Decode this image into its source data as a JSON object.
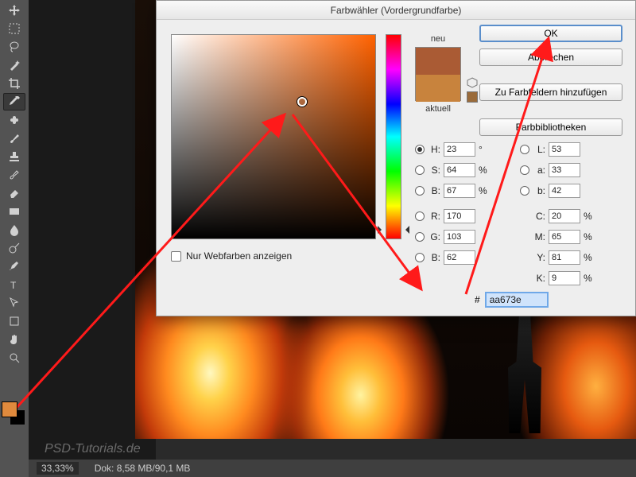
{
  "dialog": {
    "title": "Farbwähler (Vordergrundfarbe)",
    "new_label": "neu",
    "current_label": "aktuell",
    "buttons": {
      "ok": "OK",
      "cancel": "Abbrechen",
      "add_swatch": "Zu Farbfeldern hinzufügen",
      "libraries": "Farbbibliotheken"
    },
    "hsb": {
      "h": "23",
      "s": "64",
      "b": "67"
    },
    "lab": {
      "l": "53",
      "a": "33",
      "b": "42"
    },
    "rgb": {
      "r": "170",
      "g": "103",
      "b": "62"
    },
    "cmyk": {
      "c": "20",
      "m": "65",
      "y": "81",
      "k": "9"
    },
    "labels": {
      "H": "H:",
      "S": "S:",
      "Bv": "B:",
      "L": "L:",
      "a": "a:",
      "bl": "b:",
      "R": "R:",
      "G": "G:",
      "Bc": "B:",
      "C": "C:",
      "M": "M:",
      "Y": "Y:",
      "K": "K:"
    },
    "units": {
      "deg": "°",
      "pct": "%"
    },
    "hex_prefix": "#",
    "hex": "aa673e",
    "web_only": "Nur Webfarben anzeigen",
    "new_color": "#aa5b34",
    "current_color": "#c8833d"
  },
  "status": {
    "zoom": "33,33%",
    "doc": "Dok: 8,58 MB/90,1 MB"
  },
  "watermark": "PSD-Tutorials.de",
  "colors": {
    "foreground": "#e08a3d",
    "background": "#000000"
  }
}
